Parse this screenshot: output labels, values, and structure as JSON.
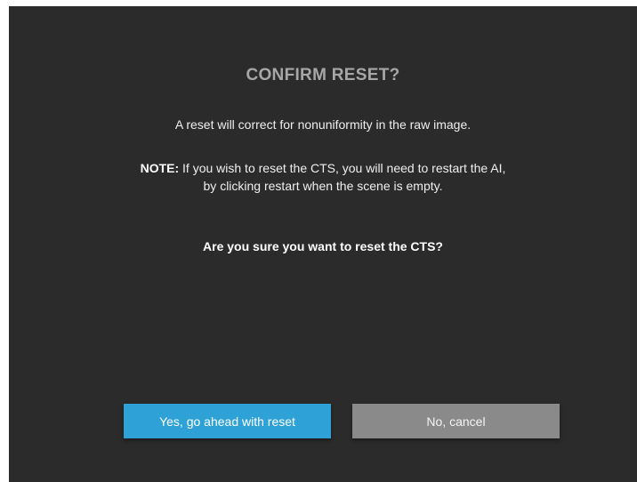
{
  "dialog": {
    "title": "CONFIRM RESET?",
    "description": "A reset will correct for nonuniformity in the raw image.",
    "note_label": "NOTE:",
    "note_text_line1": " If you wish to reset the CTS, you will need to restart the AI,",
    "note_text_line2": "by clicking restart when the scene is empty.",
    "question": "Are you sure you want to reset the CTS?",
    "confirm_label": "Yes, go ahead with reset",
    "cancel_label": "No, cancel"
  },
  "colors": {
    "background": "#2b2b2b",
    "title": "#a7a7a7",
    "confirm_button": "#2ea2d7",
    "cancel_button": "#8a8a8a"
  }
}
